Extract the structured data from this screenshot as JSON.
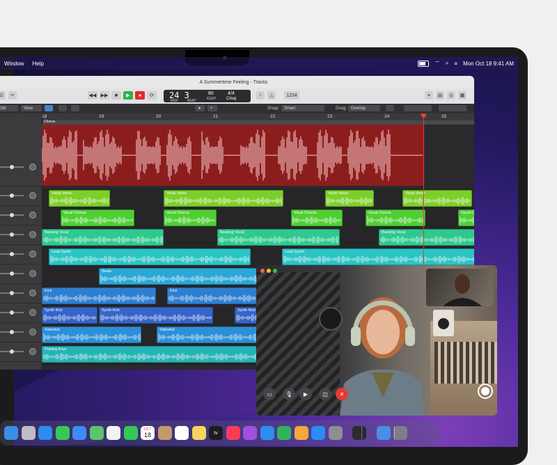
{
  "menubar": {
    "items": [
      "Window",
      "Help"
    ],
    "clock": "Mon Oct 18  9:41 AM"
  },
  "logic": {
    "title": "A Summertime Feeling - Tracks",
    "lcd": {
      "position": "24 3",
      "position_bar": "BAR",
      "position_beat": "BEAT",
      "tempo": "80",
      "tempo_label": "KEEP",
      "tempo_sub": "TEMPO",
      "signature": "4/4",
      "key": "Cmaj"
    },
    "toolbar_right_value": "1234",
    "controls": {
      "edit": "Edit",
      "view": "View",
      "snap_label": "Snap:",
      "snap_value": "Smart",
      "drag_label": "Drag:",
      "drag_value": "Overlap"
    },
    "ruler": [
      "18",
      "19",
      "20",
      "21",
      "22",
      "23",
      "24",
      "25"
    ],
    "marker": "Chorus",
    "regions": [
      {
        "track": "Vocal Verse",
        "color": "#7ccf2b"
      },
      {
        "track": "Vocal Chorus",
        "color": "#4fcf35"
      },
      {
        "track": "Backing Vocal",
        "color": "#2ec98f"
      },
      {
        "track": "Lead Synth",
        "color": "#2bc4c4"
      },
      {
        "track": "Beats",
        "color": "#2ba7d8"
      },
      {
        "track": "Kick",
        "color": "#2f7fd0"
      },
      {
        "track": "Synth Kick",
        "color": "#3564c9"
      },
      {
        "track": "Sidestick",
        "color": "#2c8fd8"
      },
      {
        "track": "Pulsing Keys",
        "color": "#26b3b6"
      }
    ]
  },
  "dock_icons": [
    "finder-icon",
    "launchpad-icon",
    "safari-icon",
    "messages-icon",
    "mail-icon",
    "maps-icon",
    "photos-icon",
    "facetime-icon",
    "calendar-icon",
    "contacts-icon",
    "reminders-icon",
    "notes-icon",
    "appletv-icon",
    "music-icon",
    "podcasts-icon",
    "keynote-icon",
    "numbers-icon",
    "pages-icon",
    "appstore-icon",
    "settings-icon",
    "logicpro-icon",
    "downloads-icon",
    "trash-icon"
  ],
  "dock": {
    "calendar_month": "OCT",
    "calendar_day": "18",
    "tv_label": "tv"
  }
}
